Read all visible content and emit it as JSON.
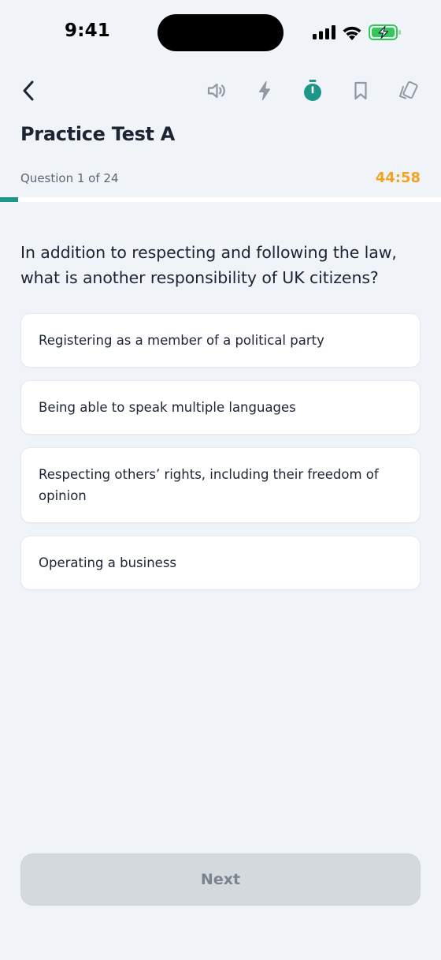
{
  "status_bar": {
    "time": "9:41"
  },
  "toolbar": {
    "icons": [
      "back-chevron-icon",
      "speaker-icon",
      "lightning-icon",
      "stopwatch-icon",
      "bookmark-icon",
      "cards-icon"
    ],
    "active_icon_color": "#1e9688",
    "inactive_icon_color": "#8f98a3"
  },
  "header": {
    "title": "Practice Test A",
    "question_counter": "Question 1 of 24",
    "timer": "44:58",
    "timer_color": "#f0a422"
  },
  "progress": {
    "current": 1,
    "total": 24,
    "color": "#1e9688"
  },
  "question": {
    "text": "In addition to respecting and following the law, what is another responsibility of UK citizens?"
  },
  "answers": [
    {
      "label": "Registering as a member of a political party"
    },
    {
      "label": "Being able to speak multiple languages"
    },
    {
      "label": "Respecting others’ rights, including their freedom of opinion"
    },
    {
      "label": "Operating a business"
    }
  ],
  "footer": {
    "next_label": "Next"
  }
}
